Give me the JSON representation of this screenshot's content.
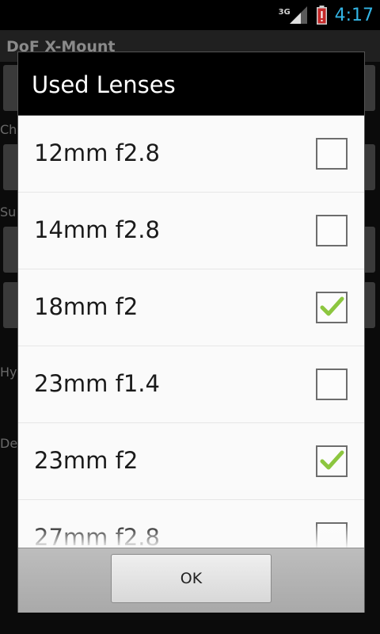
{
  "status_bar": {
    "network": "3G",
    "time": "4:17"
  },
  "app": {
    "title": "DoF X-Mount",
    "bg_labels": [
      "Ch",
      "Su",
      "Hy",
      "De"
    ]
  },
  "dialog": {
    "title": "Used Lenses",
    "lenses": [
      {
        "label": "12mm f2.8",
        "checked": false
      },
      {
        "label": "14mm f2.8",
        "checked": false
      },
      {
        "label": "18mm f2",
        "checked": true
      },
      {
        "label": "23mm f1.4",
        "checked": false
      },
      {
        "label": "23mm f2",
        "checked": true
      },
      {
        "label": "27mm f2.8",
        "checked": false
      }
    ],
    "ok_label": "OK"
  },
  "colors": {
    "clock": "#33b5e5",
    "check": "#8cc63f",
    "battery_alert": "#d32f2f"
  }
}
